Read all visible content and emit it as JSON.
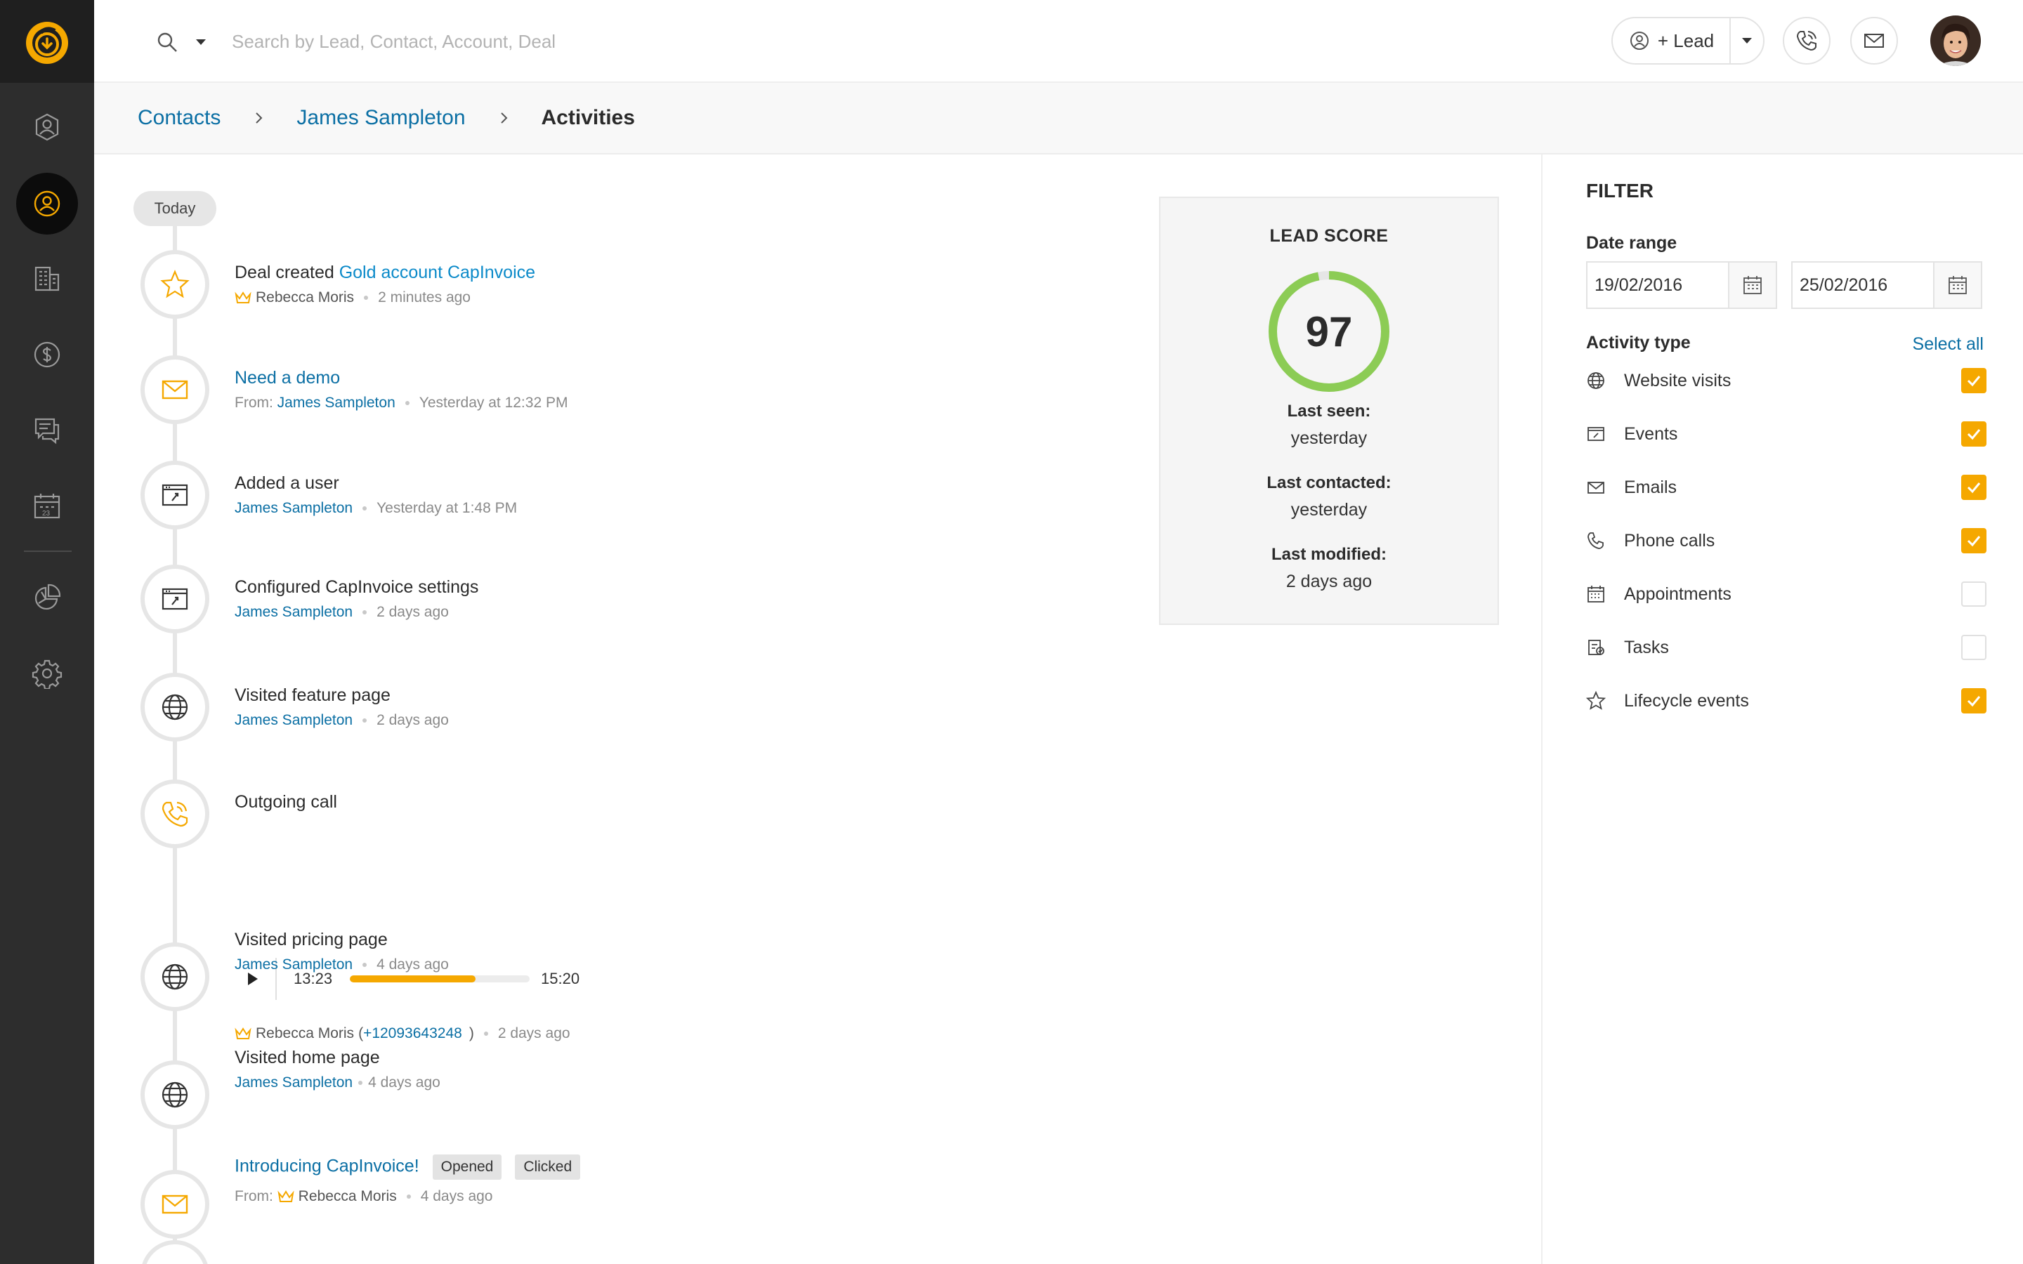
{
  "search": {
    "placeholder": "Search by Lead, Contact, Account, Deal"
  },
  "header": {
    "lead_button_label": "+ Lead"
  },
  "breadcrumb": {
    "items": [
      "Contacts",
      "James Sampleton"
    ],
    "current": "Activities"
  },
  "timeline": {
    "today_label": "Today",
    "items": [
      {
        "prefix": "Deal created ",
        "link": "Gold account CapInvoice",
        "who": "Rebecca Moris",
        "when": "2 minutes ago"
      },
      {
        "link": "Need a demo",
        "from_label": "From:",
        "who": "James Sampleton",
        "when": "Yesterday at 12:32 PM"
      },
      {
        "title": "Added a user",
        "who": "James Sampleton",
        "when": "Yesterday at 1:48 PM"
      },
      {
        "title": "Configured CapInvoice settings",
        "who": "James Sampleton",
        "when": "2 days ago"
      },
      {
        "title": "Visited feature page",
        "who": "James Sampleton",
        "when": "2 days ago"
      },
      {
        "title": "Outgoing call",
        "current_time": "13:23",
        "total_time": "15:20",
        "progress": 0.7,
        "who": "Rebecca Moris",
        "paren_open": "(",
        "phone": "+12093643248",
        "paren_close": ")",
        "when": "2 days ago"
      },
      {
        "title": "Visited pricing page",
        "who": "James Sampleton",
        "when": "4 days ago"
      },
      {
        "title": "Visited home  page",
        "who": "James Sampleton",
        "when": "4 days ago"
      },
      {
        "link": "Introducing CapInvoice!",
        "badges": [
          "Opened",
          "Clicked"
        ],
        "from_label": "From:",
        "who": "Rebecca Moris",
        "when": "4 days ago"
      }
    ]
  },
  "lead_score": {
    "title": "LEAD SCORE",
    "score": "97",
    "score_fraction": 0.97,
    "last_seen_label": "Last seen:",
    "last_seen": "yesterday",
    "last_contacted_label": "Last contacted:",
    "last_contacted": "yesterday",
    "last_modified_label": "Last modified:",
    "last_modified": "2 days ago"
  },
  "filter": {
    "title": "FILTER",
    "date_range_label": "Date range",
    "date_from": "19/02/2016",
    "date_to": "25/02/2016",
    "activity_type_label": "Activity type",
    "select_all": "Select all",
    "activity_types": [
      {
        "label": "Website visits",
        "icon": "globe-icon",
        "checked": true
      },
      {
        "label": "Events",
        "icon": "browser-icon",
        "checked": true
      },
      {
        "label": "Emails",
        "icon": "envelope-icon",
        "checked": true
      },
      {
        "label": "Phone calls",
        "icon": "phone-icon",
        "checked": true
      },
      {
        "label": "Appointments",
        "icon": "calendar-icon",
        "checked": false
      },
      {
        "label": "Tasks",
        "icon": "tasks-icon",
        "checked": false
      },
      {
        "label": "Lifecycle events",
        "icon": "star-icon",
        "checked": true
      }
    ]
  },
  "colors": {
    "accent": "#f5a800",
    "link": "#0b6fa4",
    "score_ring": "#8ccc55",
    "sidebar": "#2d2d2d"
  }
}
